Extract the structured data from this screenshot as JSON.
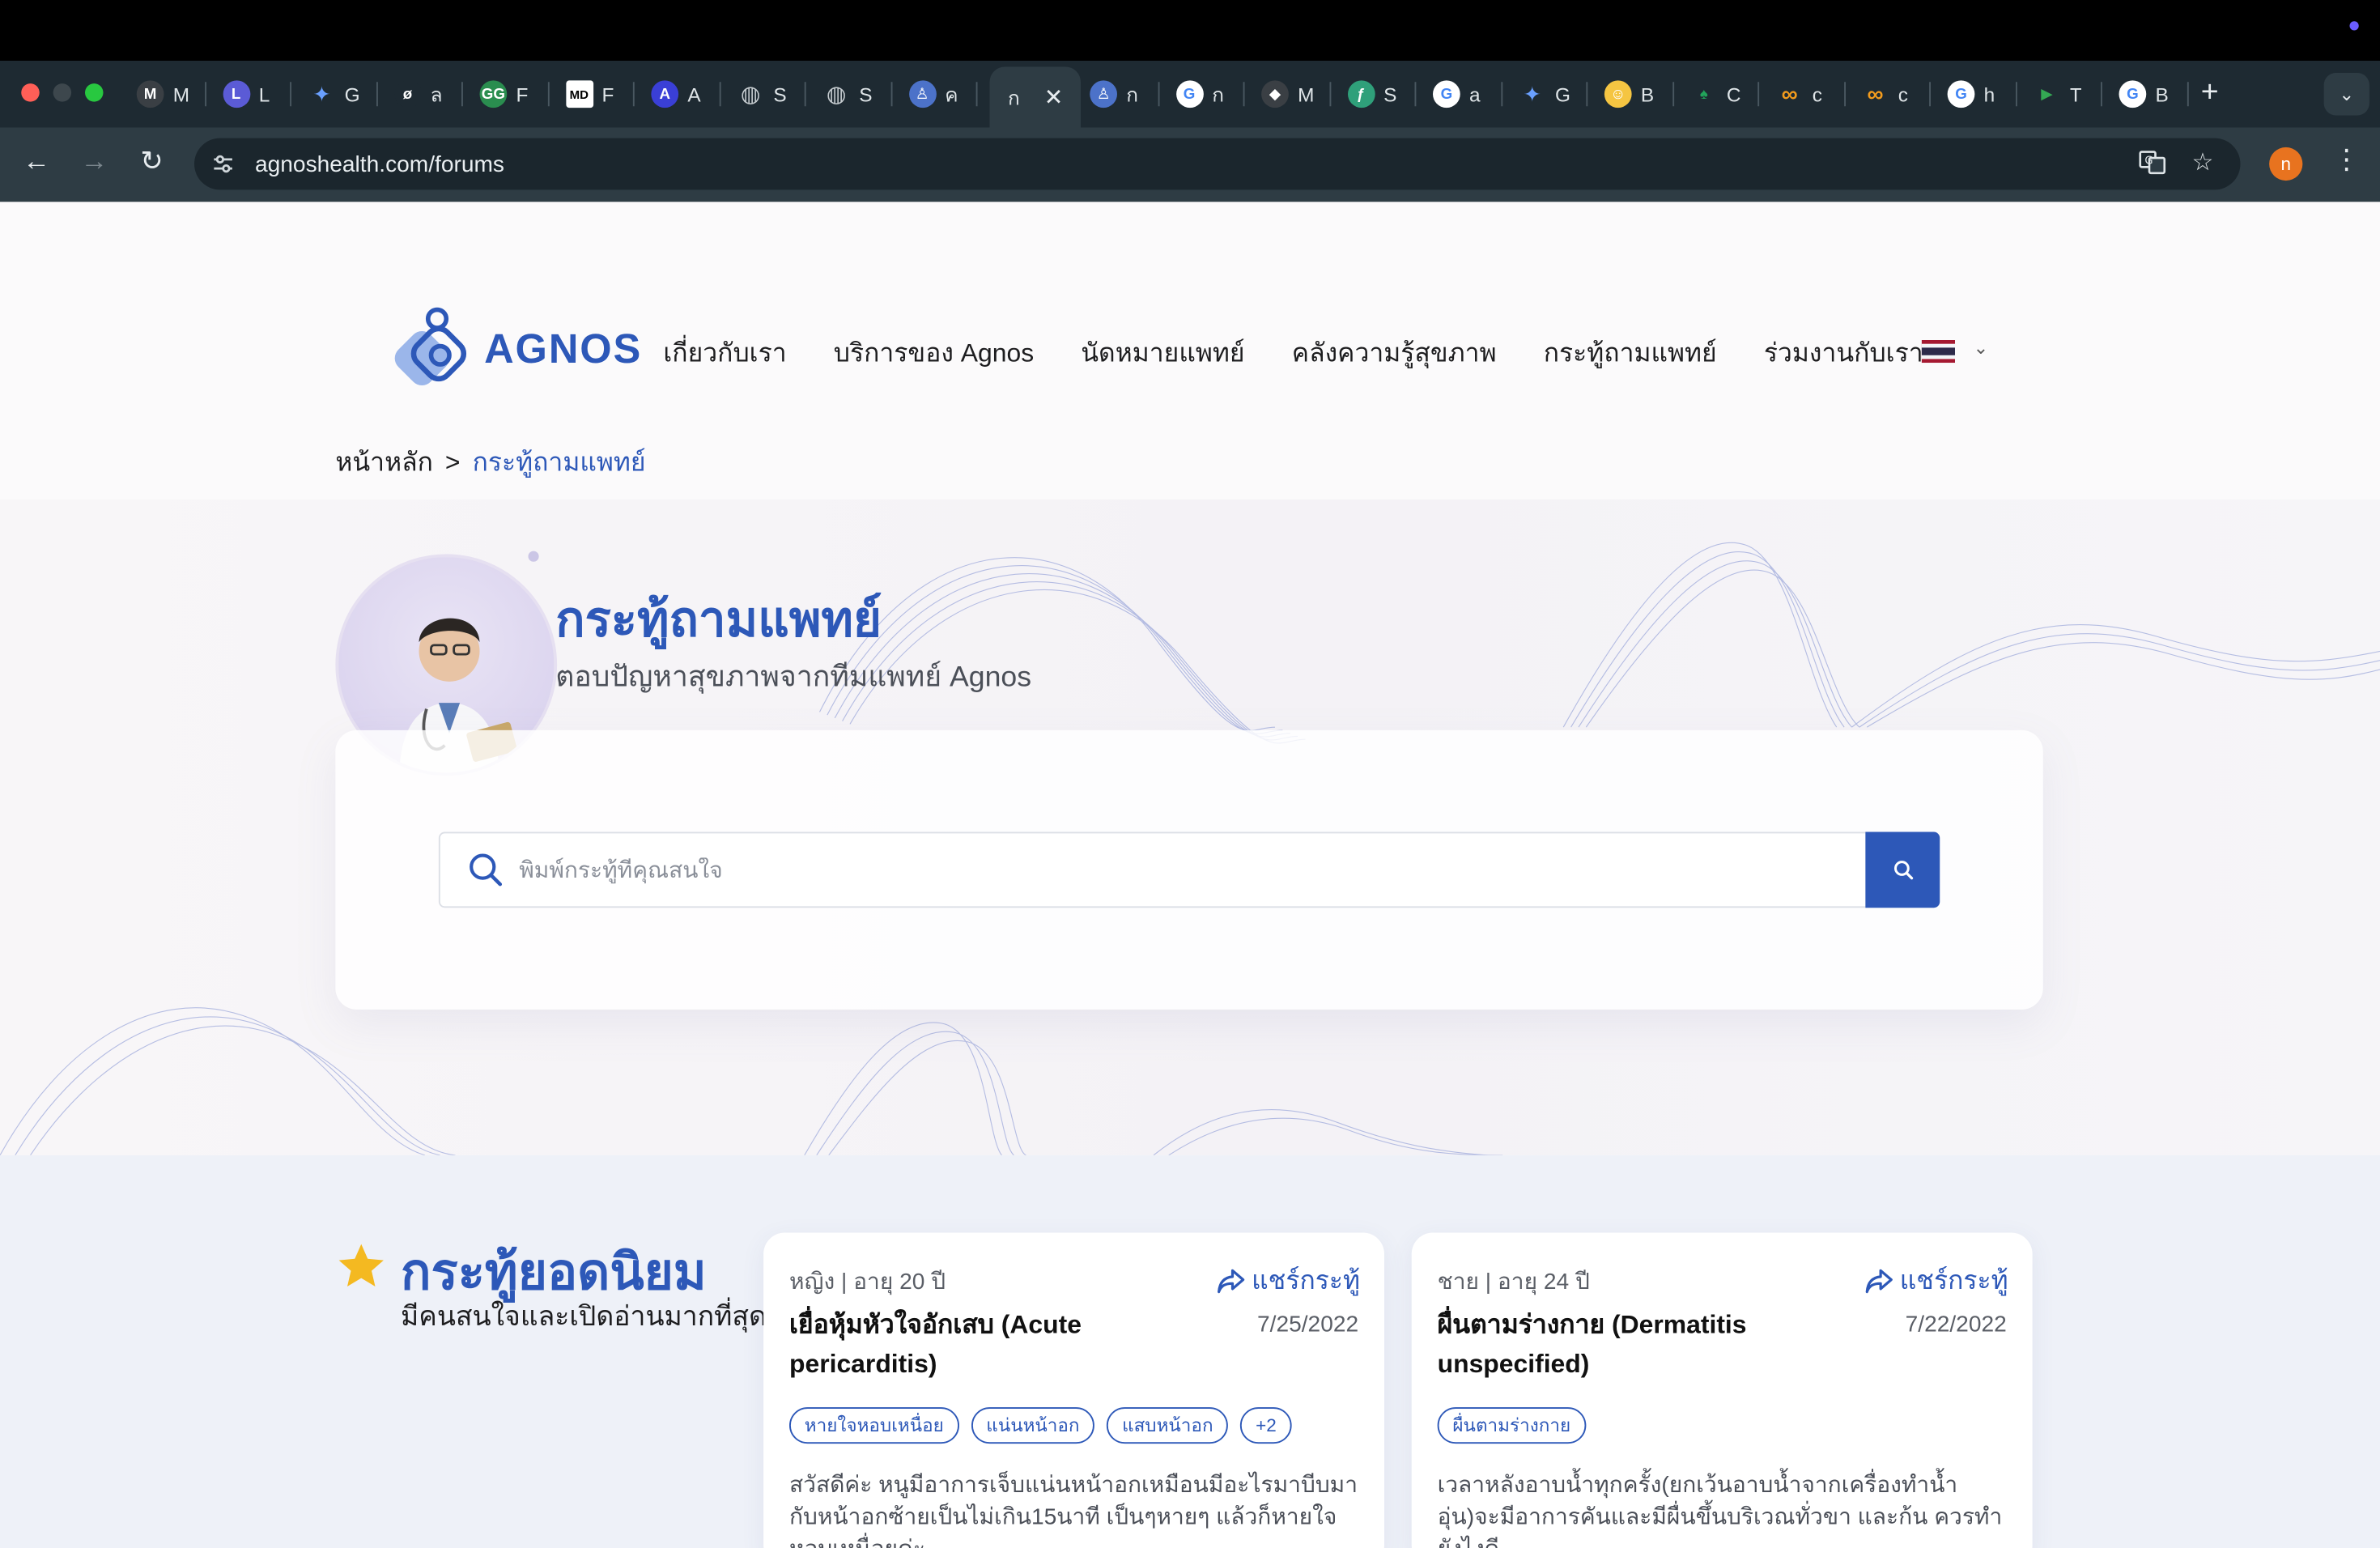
{
  "browser": {
    "tabs": [
      {
        "icon": "M",
        "title": "M",
        "color": "#3a3f44"
      },
      {
        "icon": "L",
        "title": "L",
        "color": "#5b5bd6"
      },
      {
        "icon": "gemini",
        "title": "G",
        "color": "#4a7bd8"
      },
      {
        "icon": "ø",
        "title": "ล",
        "color": "#1e2a32"
      },
      {
        "icon": "GG",
        "title": "F",
        "color": "#2a8d4f"
      },
      {
        "icon": "MD",
        "title": "F",
        "color": "#ffffff"
      },
      {
        "icon": "A",
        "title": "A",
        "color": "#3a3fd6"
      },
      {
        "icon": "globe",
        "title": "S",
        "color": "#8a9399"
      },
      {
        "icon": "globe",
        "title": "S",
        "color": "#8a9399"
      },
      {
        "icon": "agnos",
        "title": "ค",
        "color": "#4c72c9"
      }
    ],
    "active_tab_title": "ก",
    "tabs_right": [
      {
        "icon": "agnos",
        "title": "ก",
        "color": "#4c72c9"
      },
      {
        "icon": "G",
        "title": "ก",
        "color": "#ffffff"
      },
      {
        "icon": "llama",
        "title": "M",
        "color": "#3a3f44"
      },
      {
        "icon": "F",
        "title": "S",
        "color": "#2fa07a"
      },
      {
        "icon": "G",
        "title": "a",
        "color": "#ffffff"
      },
      {
        "icon": "gemini",
        "title": "G",
        "color": "#4a7bd8"
      },
      {
        "icon": "hug",
        "title": "B",
        "color": "#f5c542"
      },
      {
        "icon": "leaf",
        "title": "C",
        "color": "#22a35a"
      },
      {
        "icon": "co",
        "title": "c",
        "color": "#f29b1d"
      },
      {
        "icon": "co",
        "title": "c",
        "color": "#f29b1d"
      },
      {
        "icon": "G",
        "title": "h",
        "color": "#ffffff"
      },
      {
        "icon": "play",
        "title": "T",
        "color": "#34a853"
      },
      {
        "icon": "G",
        "title": "B",
        "color": "#ffffff"
      }
    ],
    "url": "agnoshealth.com/forums",
    "profile_initial": "n"
  },
  "site": {
    "logo_text": "AGNOS",
    "nav": [
      "เกี่ยวกับเรา",
      "บริการของ Agnos",
      "นัดหมายแพทย์",
      "คลังความรู้สุขภาพ",
      "กระทู้ถามแพทย์",
      "ร่วมงานกับเรา"
    ],
    "language": "TH"
  },
  "breadcrumb": {
    "home": "หน้าหลัก",
    "separator": ">",
    "current": "กระทู้ถามแพทย์"
  },
  "hero": {
    "title": "กระทู้ถามแพทย์",
    "subtitle": "ตอบปัญหาสุขภาพจากทีมแพทย์ Agnos",
    "search_placeholder": "พิมพ์กระทู้ที่คุณสนใจ"
  },
  "popular": {
    "title": "กระทู้ยอดนิยม",
    "subtitle": "มีคนสนใจและเปิดอ่านมากที่สุด",
    "share_label": "แชร์กระทู้",
    "posts": [
      {
        "meta": "หญิง | อายุ 20 ปี",
        "title": "เยื่อหุ้มหัวใจอักเสบ (Acute pericarditis)",
        "date": "7/25/2022",
        "tags": [
          "หายใจหอบเหนื่อย",
          "แน่นหน้าอก",
          "แสบหน้าอก",
          "+2"
        ],
        "excerpt": "สวัสดีค่ะ หนูมีอาการเจ็บแน่นหน้าอกเหมือนมีอะไรมาบีบมากับหน้าอกซ้ายเป็นไม่เกิน15นาที เป็นๆหายๆ แล้วก็หายใจหอบเหนื่อยค่ะ"
      },
      {
        "meta": "ชาย | อายุ 24 ปี",
        "title": "ผื่นตามร่างกาย (Dermatitis unspecified)",
        "date": "7/22/2022",
        "tags": [
          "ผื่นตามร่างกาย"
        ],
        "excerpt": "เวลาหลังอาบน้ำทุกครั้ง(ยกเว้นอาบน้ำจากเครื่องทำน้ำอุ่น)จะมีอาการคันและมีผื่นขึ้นบริเวณทั่วขา และก้น ควรทำยังไงดี"
      }
    ]
  },
  "colors": {
    "brand": "#2d58b8",
    "star": "#f4b921"
  }
}
